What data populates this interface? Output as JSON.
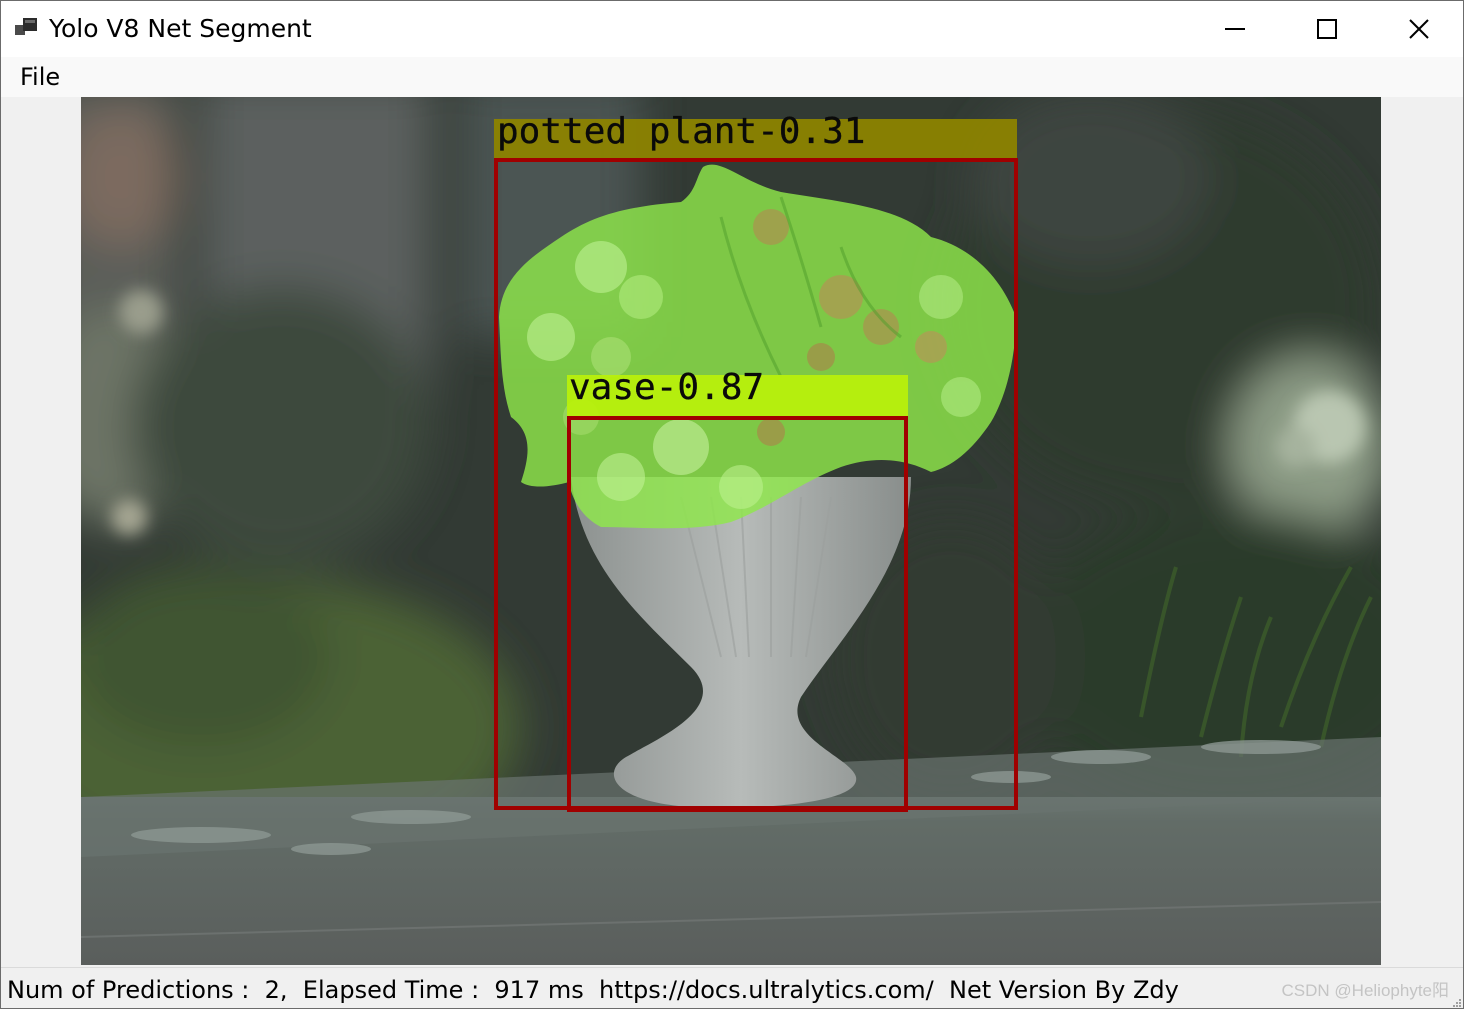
{
  "window": {
    "title": "Yolo V8 Net Segment"
  },
  "menu": {
    "items": [
      {
        "label": "File"
      }
    ]
  },
  "detections": [
    {
      "label": "potted plant-0.31",
      "color": "#8c8300",
      "box_color": "#a00000"
    },
    {
      "label": "vase-0.87",
      "color": "#b8f00c",
      "box_color": "#a00000"
    }
  ],
  "status": {
    "text": "Num of Predictions :  2,  Elapsed Time :  917 ms  https://docs.ultralytics.com/  Net Version By Zdy"
  },
  "watermark": "CSDN @Heliophyte阳",
  "icons": [
    "app-icon",
    "minimize-icon",
    "maximize-icon",
    "close-icon",
    "resize-grip-icon"
  ],
  "colors": {
    "titlebar_bg": "#ffffff",
    "menubar_bg": "#f9f9f9",
    "window_bg": "#f0f0f0",
    "mask_green": "#8fe84a"
  }
}
